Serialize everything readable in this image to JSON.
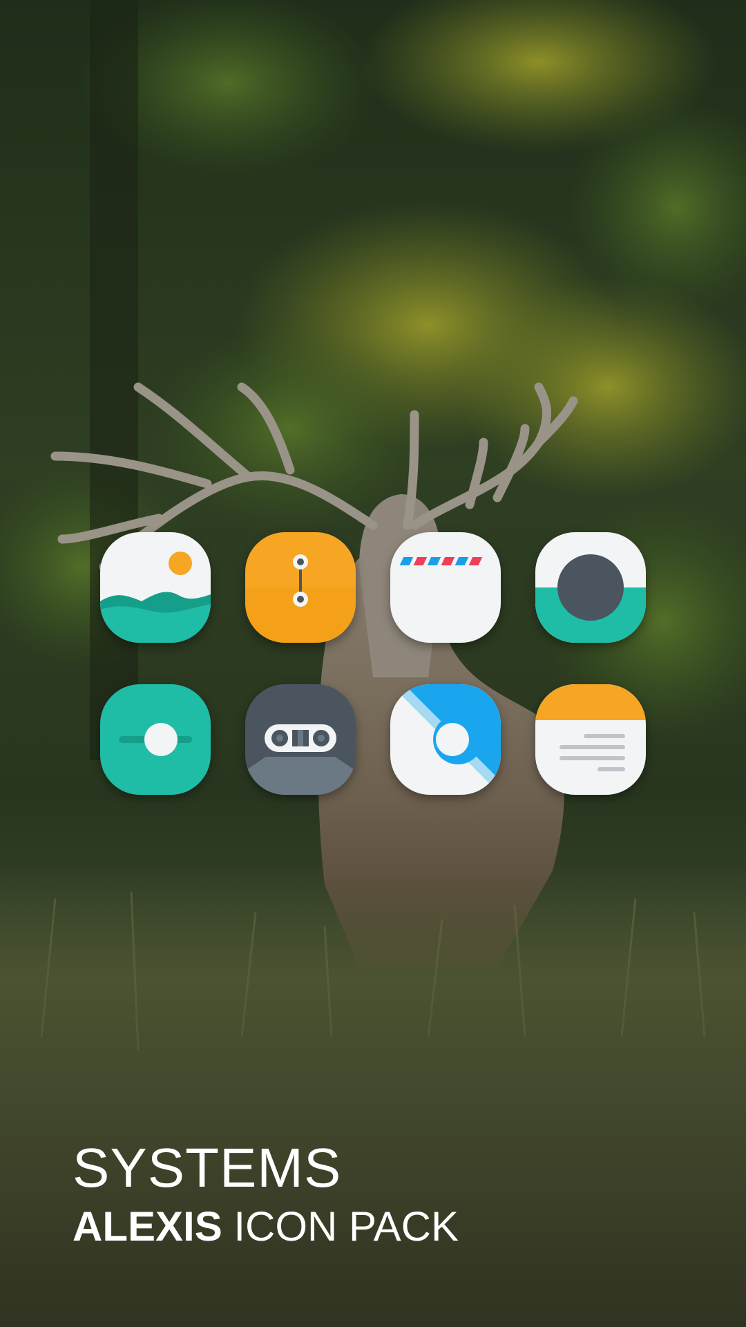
{
  "title": "SYSTEMS",
  "subtitle": {
    "brand": "ALEXIS",
    "rest": " ICON PACK"
  },
  "icons": [
    {
      "name": "gallery-icon",
      "colors": [
        "#f2f4f5",
        "#1fbca6",
        "#f6a623"
      ]
    },
    {
      "name": "file-manager-icon",
      "colors": [
        "#f6a623"
      ]
    },
    {
      "name": "email-icon",
      "colors": [
        "#f2f4f5",
        "#1a9ee8",
        "#ee3e5a"
      ]
    },
    {
      "name": "camera-icon",
      "colors": [
        "#f2f4f5",
        "#1fbca6",
        "#4a5560"
      ]
    },
    {
      "name": "settings-toggle-icon",
      "colors": [
        "#1fbca6",
        "#f2f4f5"
      ]
    },
    {
      "name": "voice-recorder-icon",
      "colors": [
        "#4a5560",
        "#f2f4f5"
      ]
    },
    {
      "name": "browser-icon",
      "colors": [
        "#f2f4f5",
        "#1aa6ef"
      ]
    },
    {
      "name": "notes-icon",
      "colors": [
        "#f6a623",
        "#f2f4f5",
        "#bfc4c9"
      ]
    }
  ]
}
